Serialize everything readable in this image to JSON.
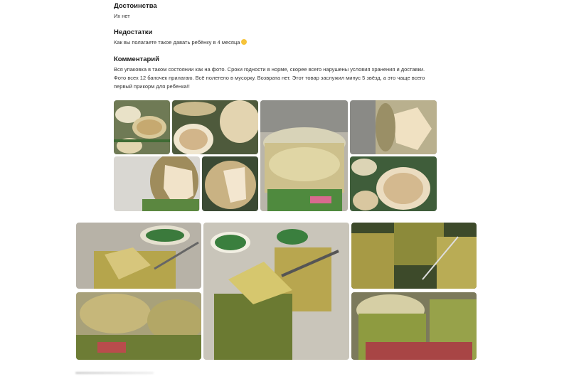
{
  "review": {
    "pros_title": "Достоинства",
    "pros_text": "Их нет",
    "cons_title": "Недостатки",
    "cons_text": "Как вы полагаете такое давать ребёнку в 4 месяца",
    "comment_title": "Комментарий",
    "comment_text": "Вся упаковка в таком состоянии как на фото. Сроки годности в норме, скорее всего нарушены условия хранения и доставки. Фото всех 12 баночек прилагаю. Всё полетело в мусорку. Возврата нет. Этот товар заслужил минус 5 звёзд, а это чаще всего первый прикорм для ребенка!!"
  },
  "emoji": "sad-face-icon",
  "colors": {
    "title": "#1a1a1a",
    "text": "#333333",
    "jar_yellow": "#c9b45a",
    "jar_green": "#7c8a3a",
    "lid_green": "#2f7a3c"
  }
}
